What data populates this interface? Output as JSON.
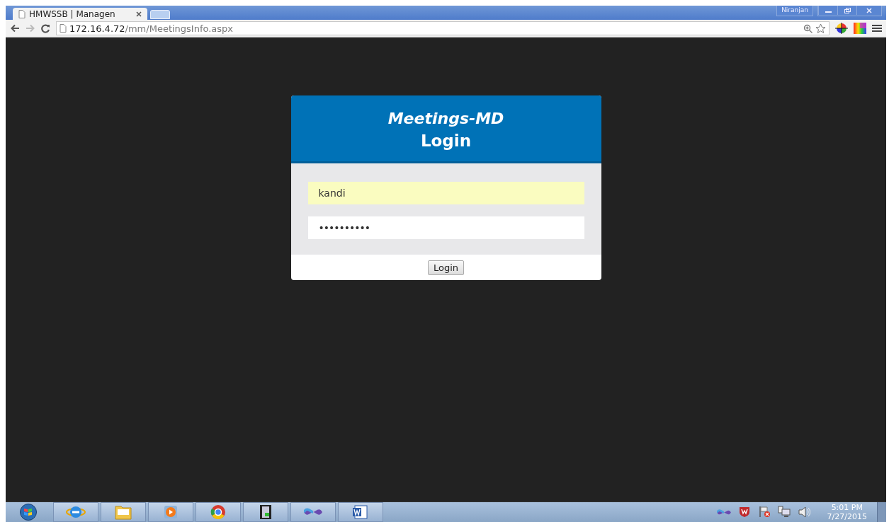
{
  "browser": {
    "tabs": [
      {
        "title": "HMWSSB | Managen",
        "selected": true
      }
    ],
    "user": "Niranjan",
    "address": {
      "host": "172.16.4.72",
      "path": "/mm/MeetingsInfo.aspx"
    }
  },
  "login": {
    "app_name": "Meetings-MD",
    "title": "Login",
    "fields": [
      {
        "kind": "text",
        "value": "kandi",
        "autofilled": true
      },
      {
        "kind": "password",
        "value": "••••••••••",
        "autofilled": false
      }
    ],
    "button": "Login"
  },
  "taskbar": {
    "apps": [
      {
        "kind": "start"
      },
      {
        "kind": "ie"
      },
      {
        "kind": "folder"
      },
      {
        "kind": "player"
      },
      {
        "kind": "chrome"
      },
      {
        "kind": "film"
      },
      {
        "kind": "studio"
      },
      {
        "kind": "word"
      }
    ],
    "tray": [
      {
        "kind": "studio"
      },
      {
        "kind": "shield"
      },
      {
        "kind": "flag"
      },
      {
        "kind": "network"
      },
      {
        "kind": "speaker"
      }
    ],
    "clock": {
      "time": "5:01 PM",
      "date": "7/27/2015"
    }
  }
}
